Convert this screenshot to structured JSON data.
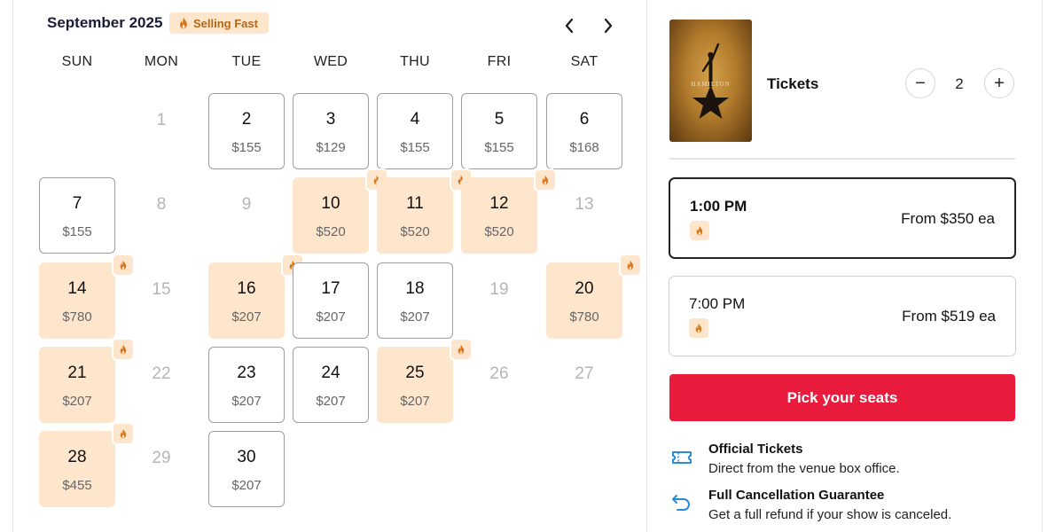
{
  "calendar": {
    "month_title": "September 2025",
    "selling_badge": "Selling Fast",
    "weekdays": [
      "SUN",
      "MON",
      "TUE",
      "WED",
      "THU",
      "FRI",
      "SAT"
    ],
    "days": [
      {
        "day": "1",
        "price": "",
        "status": "unavailable"
      },
      {
        "day": "2",
        "price": "$155",
        "status": "available"
      },
      {
        "day": "3",
        "price": "$129",
        "status": "available"
      },
      {
        "day": "4",
        "price": "$155",
        "status": "available"
      },
      {
        "day": "5",
        "price": "$155",
        "status": "available"
      },
      {
        "day": "6",
        "price": "$168",
        "status": "available"
      },
      {
        "day": "7",
        "price": "$155",
        "status": "available"
      },
      {
        "day": "8",
        "price": "",
        "status": "unavailable"
      },
      {
        "day": "9",
        "price": "",
        "status": "unavailable"
      },
      {
        "day": "10",
        "price": "$520",
        "status": "selling_fast"
      },
      {
        "day": "11",
        "price": "$520",
        "status": "selling_fast"
      },
      {
        "day": "12",
        "price": "$520",
        "status": "selling_fast"
      },
      {
        "day": "13",
        "price": "",
        "status": "unavailable"
      },
      {
        "day": "14",
        "price": "$780",
        "status": "selling_fast"
      },
      {
        "day": "15",
        "price": "",
        "status": "unavailable"
      },
      {
        "day": "16",
        "price": "$207",
        "status": "selling_fast"
      },
      {
        "day": "17",
        "price": "$207",
        "status": "available"
      },
      {
        "day": "18",
        "price": "$207",
        "status": "available"
      },
      {
        "day": "19",
        "price": "",
        "status": "unavailable"
      },
      {
        "day": "20",
        "price": "$780",
        "status": "selling_fast"
      },
      {
        "day": "21",
        "price": "$207",
        "status": "selling_fast"
      },
      {
        "day": "22",
        "price": "",
        "status": "unavailable"
      },
      {
        "day": "23",
        "price": "$207",
        "status": "available"
      },
      {
        "day": "24",
        "price": "$207",
        "status": "available"
      },
      {
        "day": "25",
        "price": "$207",
        "status": "selling_fast"
      },
      {
        "day": "26",
        "price": "",
        "status": "unavailable"
      },
      {
        "day": "27",
        "price": "",
        "status": "unavailable"
      },
      {
        "day": "28",
        "price": "$455",
        "status": "selling_fast"
      },
      {
        "day": "29",
        "price": "",
        "status": "unavailable"
      },
      {
        "day": "30",
        "price": "$207",
        "status": "available"
      }
    ]
  },
  "show": {
    "poster_text": "HAMILTON"
  },
  "tickets": {
    "label": "Tickets",
    "quantity": "2",
    "minus_symbol": "−",
    "plus_symbol": "+"
  },
  "showtimes": [
    {
      "time": "1:00 PM",
      "price_text": "From $350 ea",
      "selected": true
    },
    {
      "time": "7:00 PM",
      "price_text": "From $519 ea",
      "selected": false
    }
  ],
  "cta": {
    "label": "Pick your seats"
  },
  "features": [
    {
      "icon": "ticket-icon",
      "title": "Official Tickets",
      "description": "Direct from the venue box office."
    },
    {
      "icon": "undo-arrow-icon",
      "title": "Full Cancellation Guarantee",
      "description": "Get a full refund if your show is canceled."
    }
  ],
  "colors": {
    "accent_red": "#e81b3d",
    "selling_fast_bg": "#fde6cc",
    "flame_orange": "#d9761a",
    "feature_icon_blue": "#2a8bd6"
  }
}
